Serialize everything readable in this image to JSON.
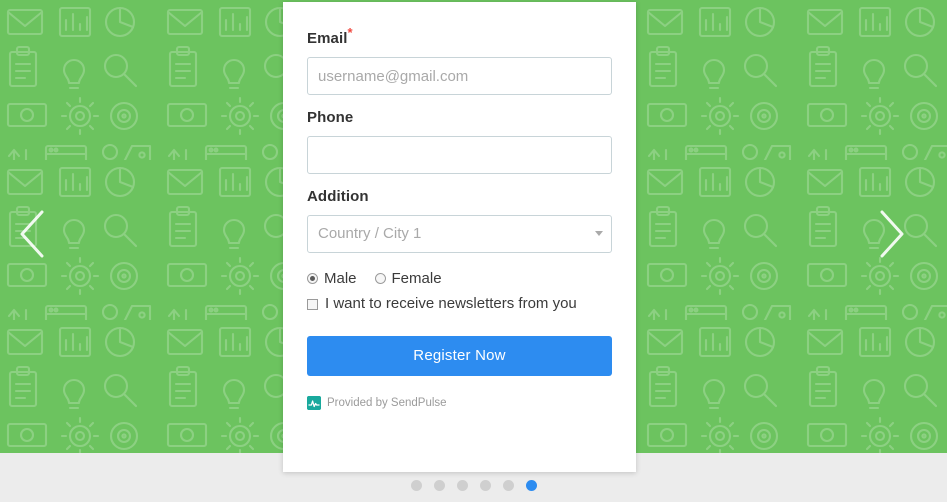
{
  "theme": {
    "hero_green": "#6cc35f",
    "accent_blue": "#2d8cf0",
    "page_gray": "#ececec",
    "required_red": "#f0473e",
    "logo_teal": "#19a99d",
    "input_border": "#c8d4d8"
  },
  "carousel": {
    "prev_label": "Previous slide",
    "next_label": "Next slide",
    "dots": [
      {
        "label": "Slide 1",
        "active": false
      },
      {
        "label": "Slide 2",
        "active": false
      },
      {
        "label": "Slide 3",
        "active": false
      },
      {
        "label": "Slide 4",
        "active": false
      },
      {
        "label": "Slide 5",
        "active": false
      },
      {
        "label": "Slide 6",
        "active": true
      }
    ]
  },
  "form": {
    "email": {
      "label": "Email",
      "required_marker": "*",
      "placeholder": "username@gmail.com",
      "value": ""
    },
    "phone": {
      "label": "Phone",
      "placeholder": "",
      "value": ""
    },
    "addition": {
      "label": "Addition",
      "selected": "Country / City 1",
      "caret_icon": "chevron-down-icon"
    },
    "gender": {
      "options": [
        {
          "label": "Male",
          "checked": true
        },
        {
          "label": "Female",
          "checked": false
        }
      ]
    },
    "newsletter": {
      "label": "I want to receive newsletters from you",
      "checked": false
    },
    "submit_label": "Register Now",
    "footer": {
      "logo_icon": "sendpulse-pulse-icon",
      "text": "Provided by SendPulse"
    }
  }
}
